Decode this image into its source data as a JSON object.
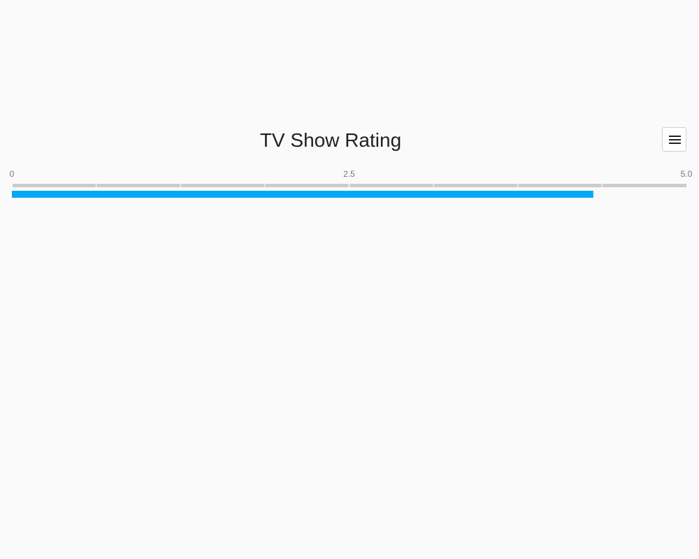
{
  "chart_data": {
    "type": "bar",
    "title": "TV Show Rating",
    "categories": [
      ""
    ],
    "values": [
      4.31
    ],
    "xlim": [
      0,
      5.0
    ],
    "tick_labels": [
      "0",
      "2.5",
      "5.0"
    ],
    "tick_values": [
      0,
      2.5,
      5.0
    ],
    "minor_ticks": [
      0.625,
      1.25,
      1.875,
      3.125,
      3.75,
      4.375
    ],
    "orientation": "horizontal",
    "grid": false,
    "legend": "none",
    "bar_color": "#03a9f4",
    "track_color": "#cccccc"
  },
  "toolbar": {
    "menu_icon": "hamburger-menu-icon"
  }
}
